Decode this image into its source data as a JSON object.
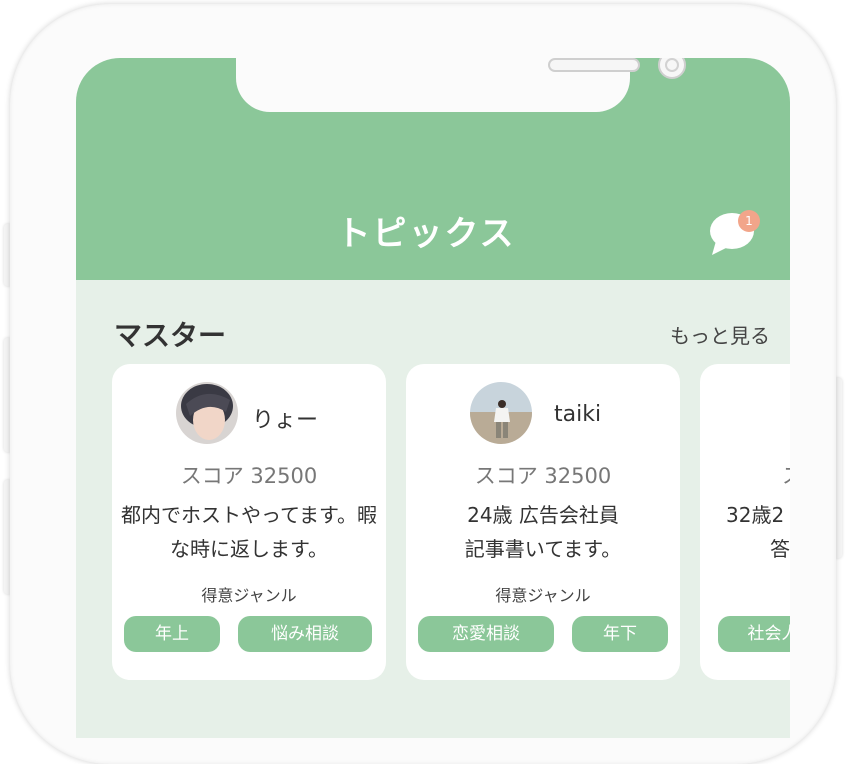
{
  "header": {
    "title": "トピックス",
    "notification_count": "1"
  },
  "section": {
    "title": "マスター",
    "more_label": "もっと見る"
  },
  "masters": [
    {
      "name": "りょー",
      "score": "スコア 32500",
      "description": "都内でホストやってます。暇な時に返します。",
      "genre_label": "得意ジャンル",
      "tags": [
        "年上",
        "悩み相談"
      ]
    },
    {
      "name": "taiki",
      "score": "スコア 32500",
      "description_line1": "24歳 広告会社員",
      "description_line2": "記事書いてます。",
      "genre_label": "得意ジャンル",
      "tags": [
        "恋愛相談",
        "年下"
      ]
    },
    {
      "score": "ス",
      "description_line1": "32歳2",
      "description_line2": "答",
      "tags": [
        "社会人"
      ]
    }
  ],
  "colors": {
    "brand_green": "#8bc799",
    "background": "#e6f0e8",
    "badge": "#f2a58a"
  },
  "icons": [
    "chat-bubble-icon",
    "avatar-ryo",
    "avatar-taiki"
  ]
}
